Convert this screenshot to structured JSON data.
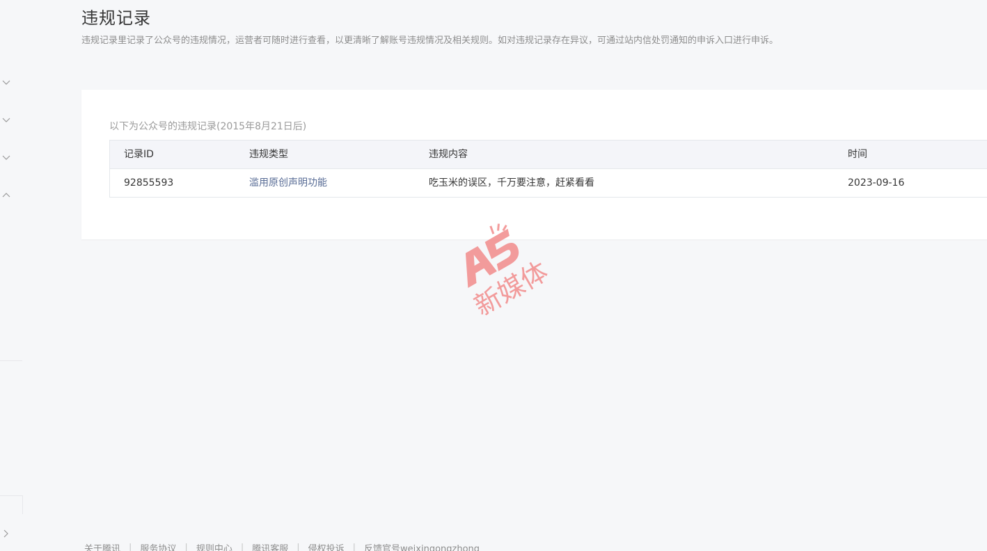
{
  "page": {
    "title": "违规记录",
    "description": "违规记录里记录了公众号的违规情况，运营者可随时进行查看，以更清晰了解账号违规情况及相关规则。如对违规记录存在异议，可通过站内信处罚通知的申诉入口进行申诉。"
  },
  "sidebar": {
    "toggles": [
      {
        "icon": "chevron-down-icon"
      },
      {
        "icon": "chevron-down-icon"
      },
      {
        "icon": "chevron-down-icon"
      },
      {
        "icon": "chevron-up-icon"
      }
    ],
    "collapse_icon": "chevron-right-icon"
  },
  "records": {
    "caption": "以下为公众号的违规记录(2015年8月21日后)",
    "columns": [
      "记录ID",
      "违规类型",
      "违规内容",
      "时间"
    ],
    "rows": [
      {
        "id": "92855593",
        "type": "滥用原创声明功能",
        "content": "吃玉米的误区，千万要注意，赶紧看看",
        "time": "2023-09-16"
      }
    ]
  },
  "watermark": {
    "logo_text": "A5",
    "text": "新媒体",
    "color": "#f08080"
  },
  "footer": {
    "links": [
      "关于腾讯",
      "服务协议",
      "规则中心",
      "腾讯客服",
      "侵权投诉",
      "反馈官号weixingongzhong"
    ]
  }
}
